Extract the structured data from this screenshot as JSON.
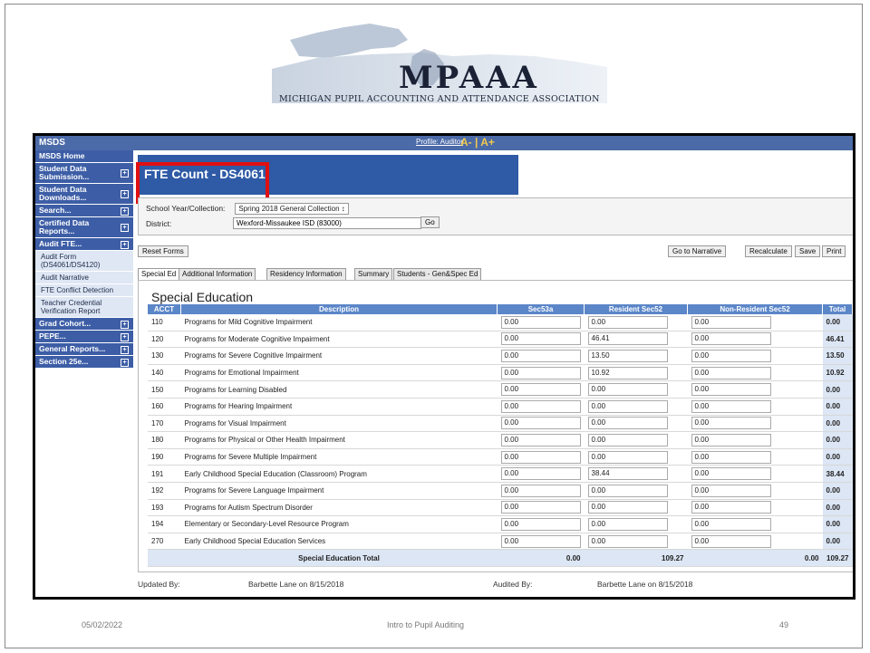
{
  "logo": {
    "acronym": "MPAAA",
    "full_name": "MICHIGAN PUPIL ACCOUNTING AND ATTENDANCE ASSOCIATION"
  },
  "app": {
    "name": "MSDS",
    "profile_link": "Profile: Auditor",
    "font_size_controls": "A- | A+"
  },
  "sidebar": {
    "items": [
      {
        "label": "MSDS Home",
        "expandable": false
      },
      {
        "label": "Student Data Submission...",
        "expandable": true
      },
      {
        "label": "Student Data Downloads...",
        "expandable": true
      },
      {
        "label": "Search...",
        "expandable": true
      },
      {
        "label": "Certified Data Reports...",
        "expandable": true
      },
      {
        "label": "Audit FTE...",
        "expandable": true
      }
    ],
    "subitems": [
      "Audit Form (DS4061/DS4120)",
      "Audit Narrative",
      "FTE Conflict Detection",
      "Teacher Credential Verification Report"
    ],
    "items_after": [
      {
        "label": "Grad Cohort...",
        "expandable": true
      },
      {
        "label": "PEPE...",
        "expandable": true
      },
      {
        "label": "General Reports...",
        "expandable": true
      },
      {
        "label": "Section 25e...",
        "expandable": true
      }
    ]
  },
  "page": {
    "title": "FTE Count - DS4061"
  },
  "selection": {
    "school_year_label": "School Year/Collection:",
    "school_year_value": "Spring 2018 General Collection ↕",
    "district_label": "District:",
    "district_value": "Wexford-Missaukee ISD (83000)",
    "go_label": "Go"
  },
  "actions": {
    "reset": "Reset Forms",
    "go_to_narrative": "Go to Narrative",
    "recalculate": "Recalculate",
    "save": "Save",
    "print": "Print"
  },
  "tabs": [
    "Special Ed",
    "Additional Information",
    "Residency Information",
    "Summary",
    "Students - Gen&Spec Ed"
  ],
  "table": {
    "section_title": "Special Education",
    "headers": [
      "ACCT",
      "Description",
      "Sec53a",
      "Resident Sec52",
      "Non-Resident Sec52",
      "Total"
    ],
    "rows": [
      {
        "acct": "110",
        "desc": "Programs for Mild Cognitive Impairment",
        "sec53a": "0.00",
        "res52": "0.00",
        "nonres52": "0.00",
        "total": "0.00"
      },
      {
        "acct": "120",
        "desc": "Programs for Moderate Cognitive Impairment",
        "sec53a": "0.00",
        "res52": "46.41",
        "nonres52": "0.00",
        "total": "46.41"
      },
      {
        "acct": "130",
        "desc": "Programs for Severe Cognitive Impairment",
        "sec53a": "0.00",
        "res52": "13.50",
        "nonres52": "0.00",
        "total": "13.50"
      },
      {
        "acct": "140",
        "desc": "Programs for Emotional Impairment",
        "sec53a": "0.00",
        "res52": "10.92",
        "nonres52": "0.00",
        "total": "10.92"
      },
      {
        "acct": "150",
        "desc": "Programs for Learning Disabled",
        "sec53a": "0.00",
        "res52": "0.00",
        "nonres52": "0.00",
        "total": "0.00"
      },
      {
        "acct": "160",
        "desc": "Programs for Hearing Impairment",
        "sec53a": "0.00",
        "res52": "0.00",
        "nonres52": "0.00",
        "total": "0.00"
      },
      {
        "acct": "170",
        "desc": "Programs for Visual Impairment",
        "sec53a": "0.00",
        "res52": "0.00",
        "nonres52": "0.00",
        "total": "0.00"
      },
      {
        "acct": "180",
        "desc": "Programs for Physical or Other Health Impairment",
        "sec53a": "0.00",
        "res52": "0.00",
        "nonres52": "0.00",
        "total": "0.00"
      },
      {
        "acct": "190",
        "desc": "Programs for Severe Multiple Impairment",
        "sec53a": "0.00",
        "res52": "0.00",
        "nonres52": "0.00",
        "total": "0.00"
      },
      {
        "acct": "191",
        "desc": "Early Childhood Special Education (Classroom) Program",
        "sec53a": "0.00",
        "res52": "38.44",
        "nonres52": "0.00",
        "total": "38.44"
      },
      {
        "acct": "192",
        "desc": "Programs for Severe Language Impairment",
        "sec53a": "0.00",
        "res52": "0.00",
        "nonres52": "0.00",
        "total": "0.00"
      },
      {
        "acct": "193",
        "desc": "Programs for Autism Spectrum Disorder",
        "sec53a": "0.00",
        "res52": "0.00",
        "nonres52": "0.00",
        "total": "0.00"
      },
      {
        "acct": "194",
        "desc": "Elementary or Secondary-Level Resource Program",
        "sec53a": "0.00",
        "res52": "0.00",
        "nonres52": "0.00",
        "total": "0.00"
      },
      {
        "acct": "270",
        "desc": "Early Childhood Special Education Services",
        "sec53a": "0.00",
        "res52": "0.00",
        "nonres52": "0.00",
        "total": "0.00"
      }
    ],
    "total_row": {
      "label": "Special Education Total",
      "sec53a": "0.00",
      "res52": "109.27",
      "nonres52": "0.00",
      "total": "109.27"
    }
  },
  "audit": {
    "updated_by_label": "Updated By:",
    "updated_by_value": "Barbette Lane on 8/15/2018",
    "audited_by_label": "Audited By:",
    "audited_by_value": "Barbette Lane on 8/15/2018"
  },
  "slide_footer": {
    "date": "05/02/2022",
    "title": "Intro to Pupil Auditing",
    "page": "49"
  },
  "colors": {
    "nav_blue": "#3d5ea6",
    "banner_blue": "#2e5aa6",
    "header_blue": "#5b86c8",
    "highlight_red": "#e01010"
  }
}
